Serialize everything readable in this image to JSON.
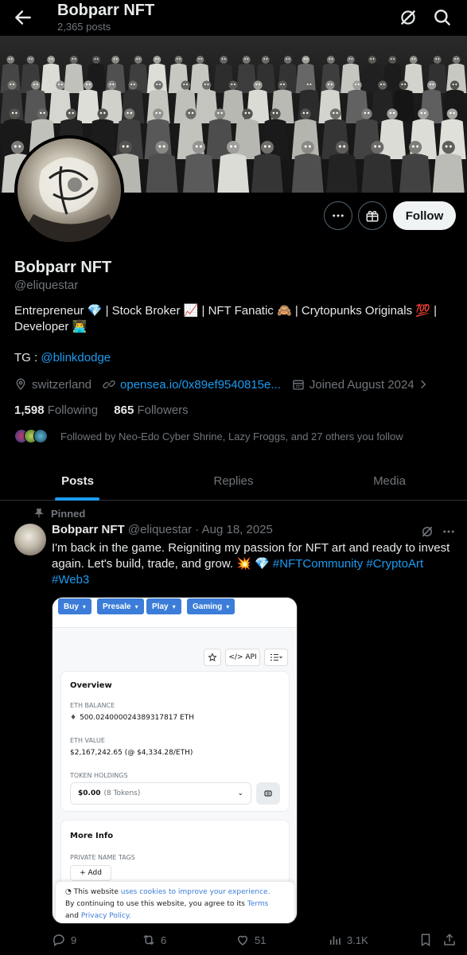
{
  "header": {
    "title": "Bobparr NFT",
    "posts_count": "2,365 posts"
  },
  "profile": {
    "name": "Bobparr NFT",
    "handle": "@eliquestar",
    "bio_line1": "Entrepreneur 💎 | Stock Broker 📈 | NFT Fanatic 🙈 | Crytopunks Originals 💯 |",
    "bio_line2": "Developer 👨‍💻",
    "tg_label": "TG :",
    "tg_link": "@blinkdodge",
    "location": "switzerland",
    "website": "opensea.io/0x89ef9540815e...",
    "joined": "Joined August 2024",
    "following_count": "1,598",
    "following_label": "Following",
    "followers_count": "865",
    "followers_label": "Followers",
    "followed_by": "Followed by Neo-Edo Cyber Shrine, Lazy Froggs, and 27 others you follow",
    "follow_button": "Follow"
  },
  "tabs": [
    {
      "label": "Posts"
    },
    {
      "label": "Replies"
    },
    {
      "label": "Media"
    }
  ],
  "post": {
    "pinned_label": "Pinned",
    "author": "Bobparr NFT",
    "handle": "@eliquestar",
    "separator": "·",
    "date": "Aug 18, 2025",
    "text": "I'm back in the game. Reigniting my passion for NFT art and ready to invest again. Let's build, trade, and grow. 💥 💎",
    "hashtags": [
      "#NFTCommunity",
      "#CryptoArt",
      "#Web3"
    ],
    "media": {
      "pills": [
        "Buy",
        "Presale",
        "Play",
        "Gaming"
      ],
      "api_label": "</> API",
      "overview_title": "Overview",
      "eth_balance_label": "ETH BALANCE",
      "eth_balance_value": "500.024000024389317817 ETH",
      "eth_value_label": "ETH VALUE",
      "eth_value_value": "$2,167,242.65 (@ $4,334.28/ETH)",
      "token_holdings_label": "TOKEN HOLDINGS",
      "token_value": "$0.00",
      "token_count": "(8 Tokens)",
      "more_info_title": "More Info",
      "private_tags_label": "PRIVATE NAME TAGS",
      "add_label": "+ Add",
      "cookie_prefix": "This website",
      "cookie_link": "uses cookies to improve your experience.",
      "cookie_line2": "By continuing to use this website, you agree to its",
      "terms_link": "Terms",
      "and_label": "and",
      "privacy_link": "Privacy Policy."
    },
    "actions": {
      "replies": "9",
      "reposts": "6",
      "likes": "51",
      "views": "3.1K"
    }
  },
  "colors": {
    "accent": "#1d9bf0",
    "muted": "#71767b",
    "text": "#e7e9ea",
    "background": "#000000"
  }
}
